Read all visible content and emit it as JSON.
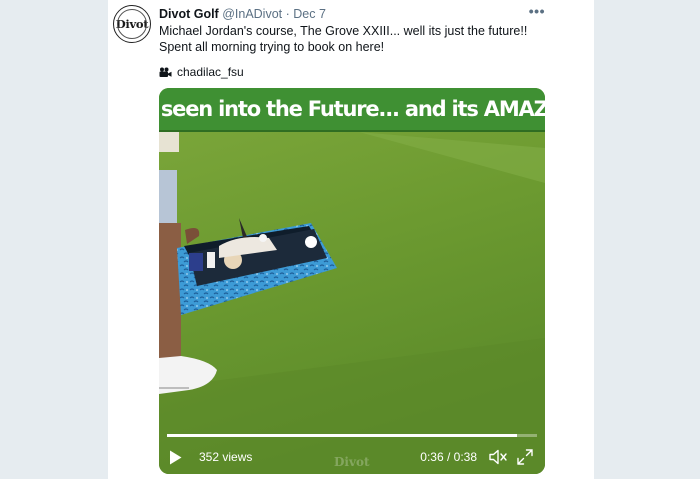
{
  "tweet": {
    "avatar_text": "Divot",
    "name": "Divot Golf",
    "handle": "@InADivot",
    "separator": "·",
    "date": "Dec 7",
    "more": "•••",
    "text": "Michael Jordan's course, The Grove XXIII... well its just the future!! Spent all morning trying to book on here!"
  },
  "media": {
    "credit": "chadilac_fsu",
    "credit_icon": "video-camera-icon",
    "banner_text": "I've seen into the Future... and its AMAZING",
    "views": "352 views",
    "time": "0:36 / 0:38",
    "progress": 0.947
  },
  "colors": {
    "page_bg": "#e6ecf0",
    "banner_green": "#3f9033",
    "grass": "#6c9a30",
    "tray_blue": "#3d9bd6"
  }
}
